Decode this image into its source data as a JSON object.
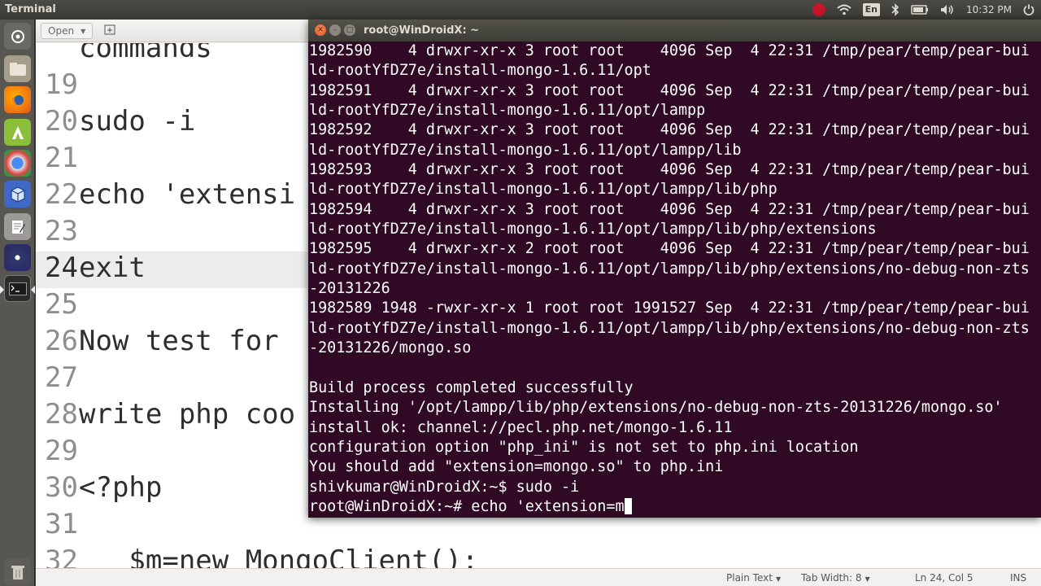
{
  "top_panel": {
    "title": "Terminal",
    "keyboard_layout": "En",
    "clock": "10:32 PM",
    "indicators": [
      "ubuntu-one-icon",
      "wifi-icon",
      "keyboard-icon",
      "bluetooth-icon",
      "battery-icon",
      "volume-icon",
      "power-icon"
    ]
  },
  "launcher": {
    "items": [
      "dash-icon",
      "files-icon",
      "firefox-icon",
      "android-studio-icon",
      "chrome-icon",
      "virtualbox-icon",
      "text-editor-icon",
      "eclipse-icon",
      "terminal-icon",
      "trash-icon"
    ]
  },
  "gedit": {
    "open_label": "Open",
    "lines": [
      {
        "num": "",
        "text": "commands",
        "current": false
      },
      {
        "num": "19",
        "text": "",
        "current": false
      },
      {
        "num": "20",
        "text": "sudo -i",
        "current": false
      },
      {
        "num": "21",
        "text": "",
        "current": false
      },
      {
        "num": "22",
        "text": "echo 'extensi",
        "current": false
      },
      {
        "num": "23",
        "text": "",
        "current": false
      },
      {
        "num": "24",
        "text": "exit",
        "current": true
      },
      {
        "num": "25",
        "text": "",
        "current": false
      },
      {
        "num": "26",
        "text": "Now test for",
        "current": false
      },
      {
        "num": "27",
        "text": "",
        "current": false
      },
      {
        "num": "28",
        "text": "write php coo",
        "current": false
      },
      {
        "num": "29",
        "text": "",
        "current": false
      },
      {
        "num": "30",
        "text": "<?php",
        "current": false
      },
      {
        "num": "31",
        "text": "",
        "current": false
      },
      {
        "num": "32",
        "text": "   $m=new MongoClient();",
        "current": false
      }
    ],
    "status": {
      "language": "Plain Text",
      "tab_width": "Tab Width: 8",
      "position": "Ln 24, Col 5",
      "mode": "INS"
    }
  },
  "terminal": {
    "title": "root@WinDroidX: ~",
    "lines": [
      "1982590    4 drwxr-xr-x 3 root root    4096 Sep  4 22:31 /tmp/pear/temp/pear-bui",
      "ld-rootYfDZ7e/install-mongo-1.6.11/opt",
      "1982591    4 drwxr-xr-x 3 root root    4096 Sep  4 22:31 /tmp/pear/temp/pear-bui",
      "ld-rootYfDZ7e/install-mongo-1.6.11/opt/lampp",
      "1982592    4 drwxr-xr-x 3 root root    4096 Sep  4 22:31 /tmp/pear/temp/pear-bui",
      "ld-rootYfDZ7e/install-mongo-1.6.11/opt/lampp/lib",
      "1982593    4 drwxr-xr-x 3 root root    4096 Sep  4 22:31 /tmp/pear/temp/pear-bui",
      "ld-rootYfDZ7e/install-mongo-1.6.11/opt/lampp/lib/php",
      "1982594    4 drwxr-xr-x 3 root root    4096 Sep  4 22:31 /tmp/pear/temp/pear-bui",
      "ld-rootYfDZ7e/install-mongo-1.6.11/opt/lampp/lib/php/extensions",
      "1982595    4 drwxr-xr-x 2 root root    4096 Sep  4 22:31 /tmp/pear/temp/pear-bui",
      "ld-rootYfDZ7e/install-mongo-1.6.11/opt/lampp/lib/php/extensions/no-debug-non-zts",
      "-20131226",
      "1982589 1948 -rwxr-xr-x 1 root root 1991527 Sep  4 22:31 /tmp/pear/temp/pear-bui",
      "ld-rootYfDZ7e/install-mongo-1.6.11/opt/lampp/lib/php/extensions/no-debug-non-zts",
      "-20131226/mongo.so",
      "",
      "Build process completed successfully",
      "Installing '/opt/lampp/lib/php/extensions/no-debug-non-zts-20131226/mongo.so'",
      "install ok: channel://pecl.php.net/mongo-1.6.11",
      "configuration option \"php_ini\" is not set to php.ini location",
      "You should add \"extension=mongo.so\" to php.ini",
      "shivkumar@WinDroidX:~$ sudo -i"
    ],
    "prompt_line": "root@WinDroidX:~# echo 'extension=m"
  },
  "colors": {
    "terminal_bg": "#300a24",
    "terminal_fg": "#ffffff",
    "panel_bg": "#3c3b37",
    "close_button": "#e2531c"
  }
}
